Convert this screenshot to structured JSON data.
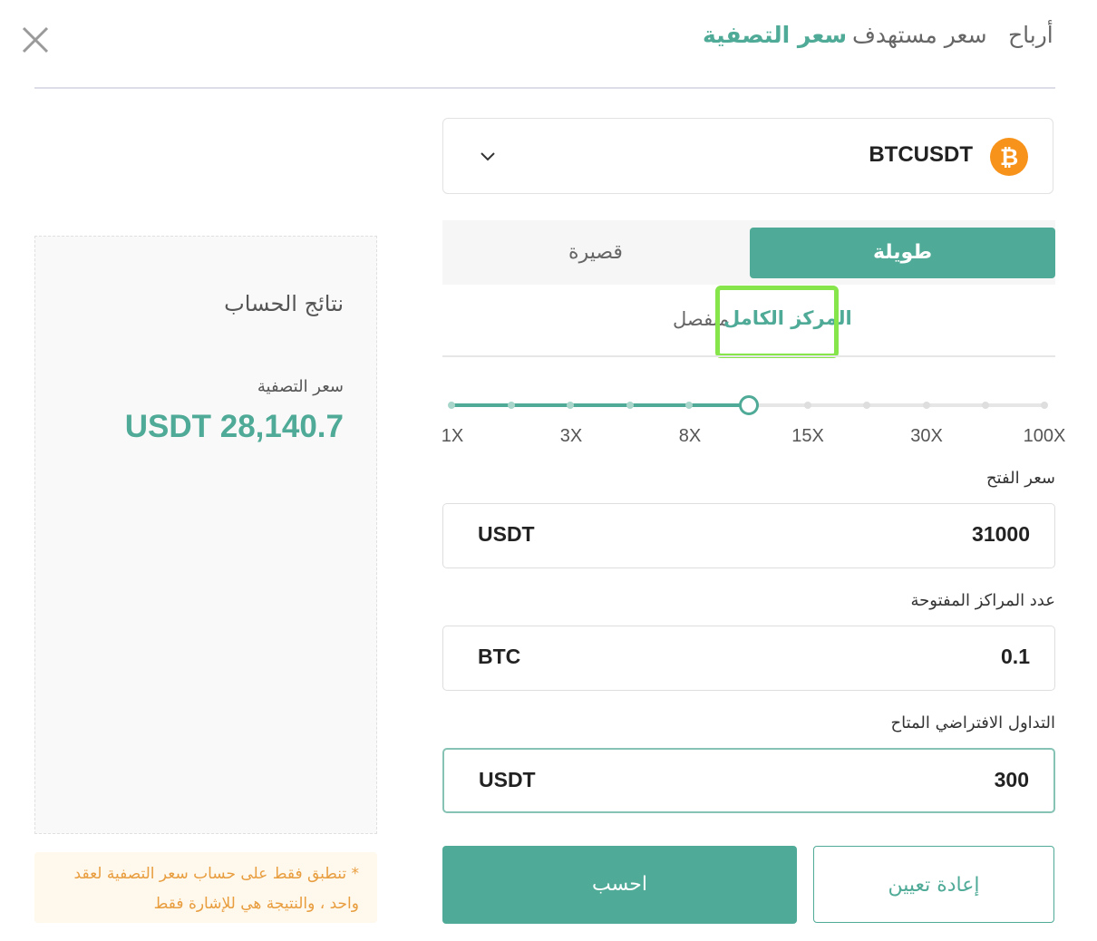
{
  "header": {
    "tabs": [
      {
        "label": "أرباح",
        "active": false
      },
      {
        "label": "سعر مستهدف",
        "active": false
      },
      {
        "label": "سعر التصفية",
        "active": true
      }
    ],
    "close_icon": "close-icon"
  },
  "pair": {
    "symbol": "BTCUSDT",
    "icon": "bitcoin-icon",
    "dropdown_icon": "chevron-down-icon"
  },
  "side": {
    "long": "طويلة",
    "short": "قصيرة",
    "selected": "long"
  },
  "margin_mode": {
    "cross": "المركز الكامل",
    "isolated": "منفصل",
    "selected": "cross"
  },
  "leverage": {
    "tick_labels": [
      "1X",
      "3X",
      "8X",
      "15X",
      "30X",
      "100X"
    ],
    "selected_fraction": 0.5
  },
  "form": {
    "entry_price": {
      "label": "سعر الفتح",
      "value": "31000",
      "unit": "USDT"
    },
    "quantity": {
      "label": "عدد المراكز المفتوحة",
      "value": "0.1",
      "unit": "BTC"
    },
    "balance": {
      "label": "التداول الافتراضي المتاح",
      "value": "300",
      "unit": "USDT"
    }
  },
  "buttons": {
    "calculate": "احسب",
    "reset": "إعادة تعيين"
  },
  "results": {
    "title": "نتائج الحساب",
    "liq_label": "سعر التصفية",
    "liq_value": "USDT 28,140.7"
  },
  "note": "* تنطبق فقط على حساب سعر التصفية لعقد واحد ، والنتيجة هي للإشارة فقط",
  "colors": {
    "accent": "#4fab97",
    "bitcoin": "#f7931a",
    "note_bg": "#fff8ec",
    "note_text": "#e89d3e",
    "highlight": "#86e54a"
  }
}
